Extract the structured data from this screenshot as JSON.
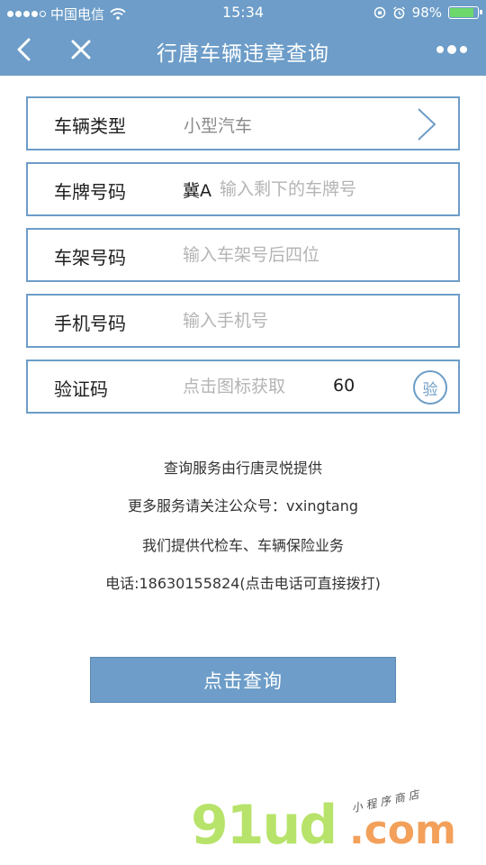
{
  "status_bar": {
    "carrier": "中国电信",
    "time": "15:34",
    "battery": "98%",
    "battery_level": 0.98
  },
  "nav": {
    "title": "行唐车辆违章查询"
  },
  "form": {
    "vehicle_type": {
      "label": "车辆类型",
      "value": "小型汽车"
    },
    "plate": {
      "label": "车牌号码",
      "prefix": "冀A",
      "placeholder": "输入剩下的车牌号"
    },
    "frame": {
      "label": "车架号码",
      "placeholder": "输入车架号后四位"
    },
    "phone": {
      "label": "手机号码",
      "placeholder": "输入手机号"
    },
    "code": {
      "label": "验证码",
      "placeholder": "点击图标获取",
      "countdown": "60",
      "button_label": "验"
    }
  },
  "info": {
    "line1": "查询服务由行唐灵悦提供",
    "line2": "更多服务请关注公众号：vxingtang",
    "line3": "我们提供代检车、车辆保险业务",
    "line4": "电话:18630155824(点击电话可直接拨打)"
  },
  "submit": {
    "label": "点击查询"
  },
  "watermark": {
    "main": "91ud",
    "dot": ".com",
    "sub": "小程序商店"
  },
  "colors": {
    "accent": "#6d9dc8",
    "watermark_green": "#b7e36a",
    "watermark_orange": "#f3a05b"
  }
}
